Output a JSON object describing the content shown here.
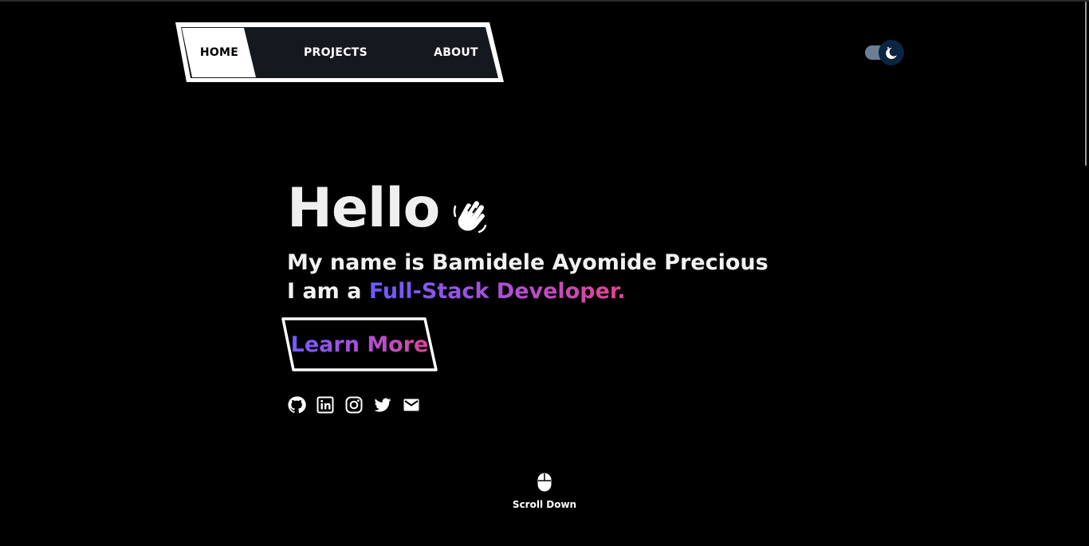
{
  "nav": {
    "items": [
      {
        "label": "HOME",
        "active": true
      },
      {
        "label": "PROJECTS",
        "active": false
      },
      {
        "label": "ABOUT",
        "active": false
      }
    ]
  },
  "theme_toggle": {
    "icon": "moon-icon",
    "mode": "dark"
  },
  "hero": {
    "greeting": "Hello",
    "greeting_icon": "waving-hand-icon",
    "intro": "My name is Bamidele Ayomide Precious",
    "role_prefix": "I am a ",
    "role": "Full-Stack Developer.",
    "cta_label": "Learn More"
  },
  "socials": [
    {
      "icon": "github-icon"
    },
    {
      "icon": "linkedin-icon"
    },
    {
      "icon": "instagram-icon"
    },
    {
      "icon": "twitter-icon"
    },
    {
      "icon": "mail-icon"
    }
  ],
  "scroll_down": {
    "label": "Scroll Down",
    "icon": "mouse-icon"
  },
  "colors": {
    "background": "#000000",
    "nav_background": "#14181f",
    "toggle_knob": "#0b2441",
    "gradient_start": "#6a5cff",
    "gradient_end": "#e0468f"
  }
}
